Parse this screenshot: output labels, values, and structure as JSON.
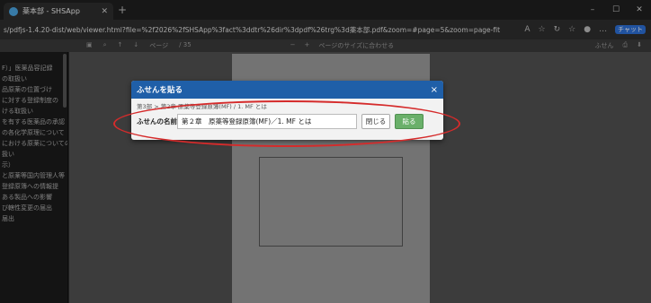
{
  "browser": {
    "tab_title": "薬本部 - SHSApp",
    "url": "s/pdfjs-1.4.20-dist/web/viewer.html?file=%2f2026%2fSHSApp%3fact%3ddtr%26dir%3dpdf%26trg%3d薬本部.pdf&zoom=#page=5&zoom=page-fit",
    "new_tab": "+",
    "copilot_label": "チャット"
  },
  "pdf_toolbar": {
    "page_label": "ページ",
    "page_total": "/ 35",
    "zoom_label": "ページのサイズに合わせる",
    "note_label": "ふせん"
  },
  "sidebar": {
    "items": [
      "F）」医薬品容記録",
      "の取扱い",
      "品原薬の位置づけ",
      "に対する登録制度の",
      "ける取扱い",
      "を有する医薬品の承認",
      "の各化学原理について",
      "における原薬についての",
      "扱い",
      "",
      "",
      "",
      "示）",
      "と原薬等国内管理人等",
      "登録原簿への情報提",
      "",
      "ある製品への影響",
      "び轄性変更の届出",
      "届出"
    ]
  },
  "dialog": {
    "title": "ふせんを貼る",
    "close_icon": "×",
    "path": "第3部 > 第2章 原薬等登録原簿(MF) / 1. MF とは",
    "name_label": "ふせんの名前",
    "name_value": "第２章　原薬等登録原簿(MF)／1. MF とは",
    "close_button": "閉じる",
    "paste_button": "貼る"
  }
}
